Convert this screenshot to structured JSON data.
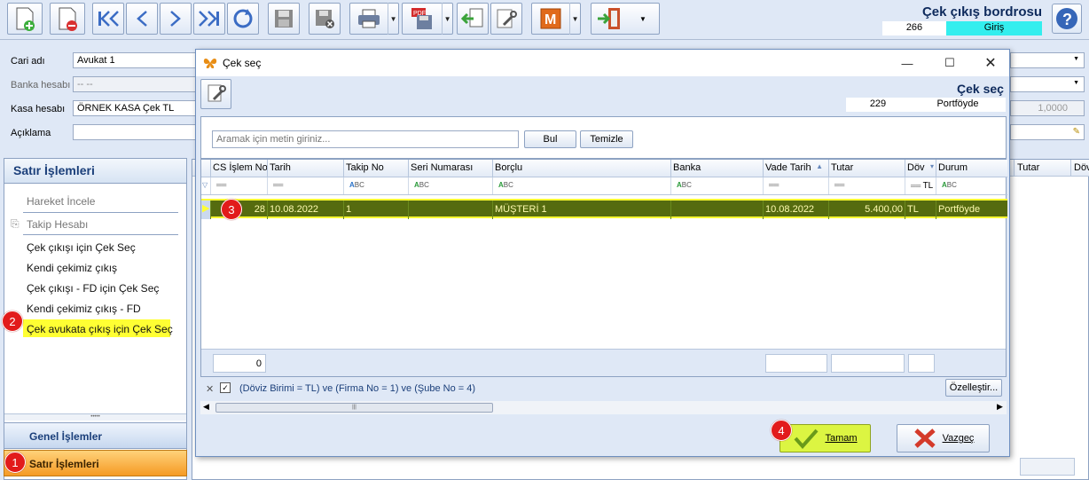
{
  "toolbar": {
    "buttons": [
      "new-document",
      "delete-document",
      "first",
      "previous",
      "next",
      "last",
      "refresh",
      "save",
      "save-close",
      "print",
      "pdf",
      "import",
      "tools",
      "report-m",
      "exit"
    ]
  },
  "header": {
    "title": "Çek çıkış bordrosu",
    "number": "266",
    "status": "Giriş"
  },
  "form": {
    "cari_label": "Cari adı",
    "cari_value": "Avukat 1",
    "banka_label": "Banka hesabı",
    "banka_value": "-- --",
    "kasa_label": "Kasa hesabı",
    "kasa_value": "ÖRNEK KASA Çek TL",
    "aciklama_label": "Açıklama",
    "aciklama_value": "",
    "rate_value": "1,0000"
  },
  "sidebar": {
    "title": "Satır İşlemleri",
    "items": [
      {
        "label": "Hareket İncele"
      },
      {
        "label": "Takip Hesabı"
      },
      {
        "label": "Çek çıkışı için Çek Seç"
      },
      {
        "label": "Kendi çekimiz çıkış"
      },
      {
        "label": "Çek çıkışı - FD için Çek Seç"
      },
      {
        "label": "Kendi çekimiz çıkış - FD"
      },
      {
        "label": "Çek avukata çıkış için Çek Seç"
      }
    ],
    "nav_general": "Genel İşlemler",
    "nav_rows": "Satır İşlemleri"
  },
  "background_grid": {
    "tutar_header": "Tutar",
    "dov_header": "Döv"
  },
  "dialog": {
    "title": "Çek seç",
    "heading": "Çek seç",
    "count": "229",
    "status": "Portföyde",
    "search_placeholder": "Aramak için metin giriniz...",
    "bul_label": "Bul",
    "temizle_label": "Temizle",
    "columns": [
      "CS İşlem No",
      "Tarih",
      "Takip No",
      "Seri Numarası",
      "Borçlu",
      "Banka",
      "Vade Tarih",
      "Tutar",
      "Döv",
      "Durum"
    ],
    "rows": [
      {
        "islem_no": "28",
        "tarih": "10.08.2022",
        "takip_no": "1",
        "seri_no": "",
        "borclu": "MÜŞTERİ 1",
        "banka": "",
        "vade": "10.08.2022",
        "tutar": "5.400,00",
        "dov": "TL",
        "durum": "Portföyde"
      }
    ],
    "filter_dov": "TL",
    "footer_count": "0",
    "filter_text": "(Döviz Birimi = TL) ve (Firma No = 1) ve (Şube No = 4)",
    "customize_label": "Özelleştir...",
    "ok_label": "Tamam",
    "cancel_label": "Vazgeç"
  },
  "badges": [
    "1",
    "2",
    "3",
    "4"
  ],
  "colors": {
    "selected_row": "#556b0f",
    "selected_text": "#fffbb0",
    "highlight": "#ffff33",
    "ok_button": "#dcf542",
    "status_cyan": "#33eeee",
    "badge_red": "#e21b1b"
  }
}
